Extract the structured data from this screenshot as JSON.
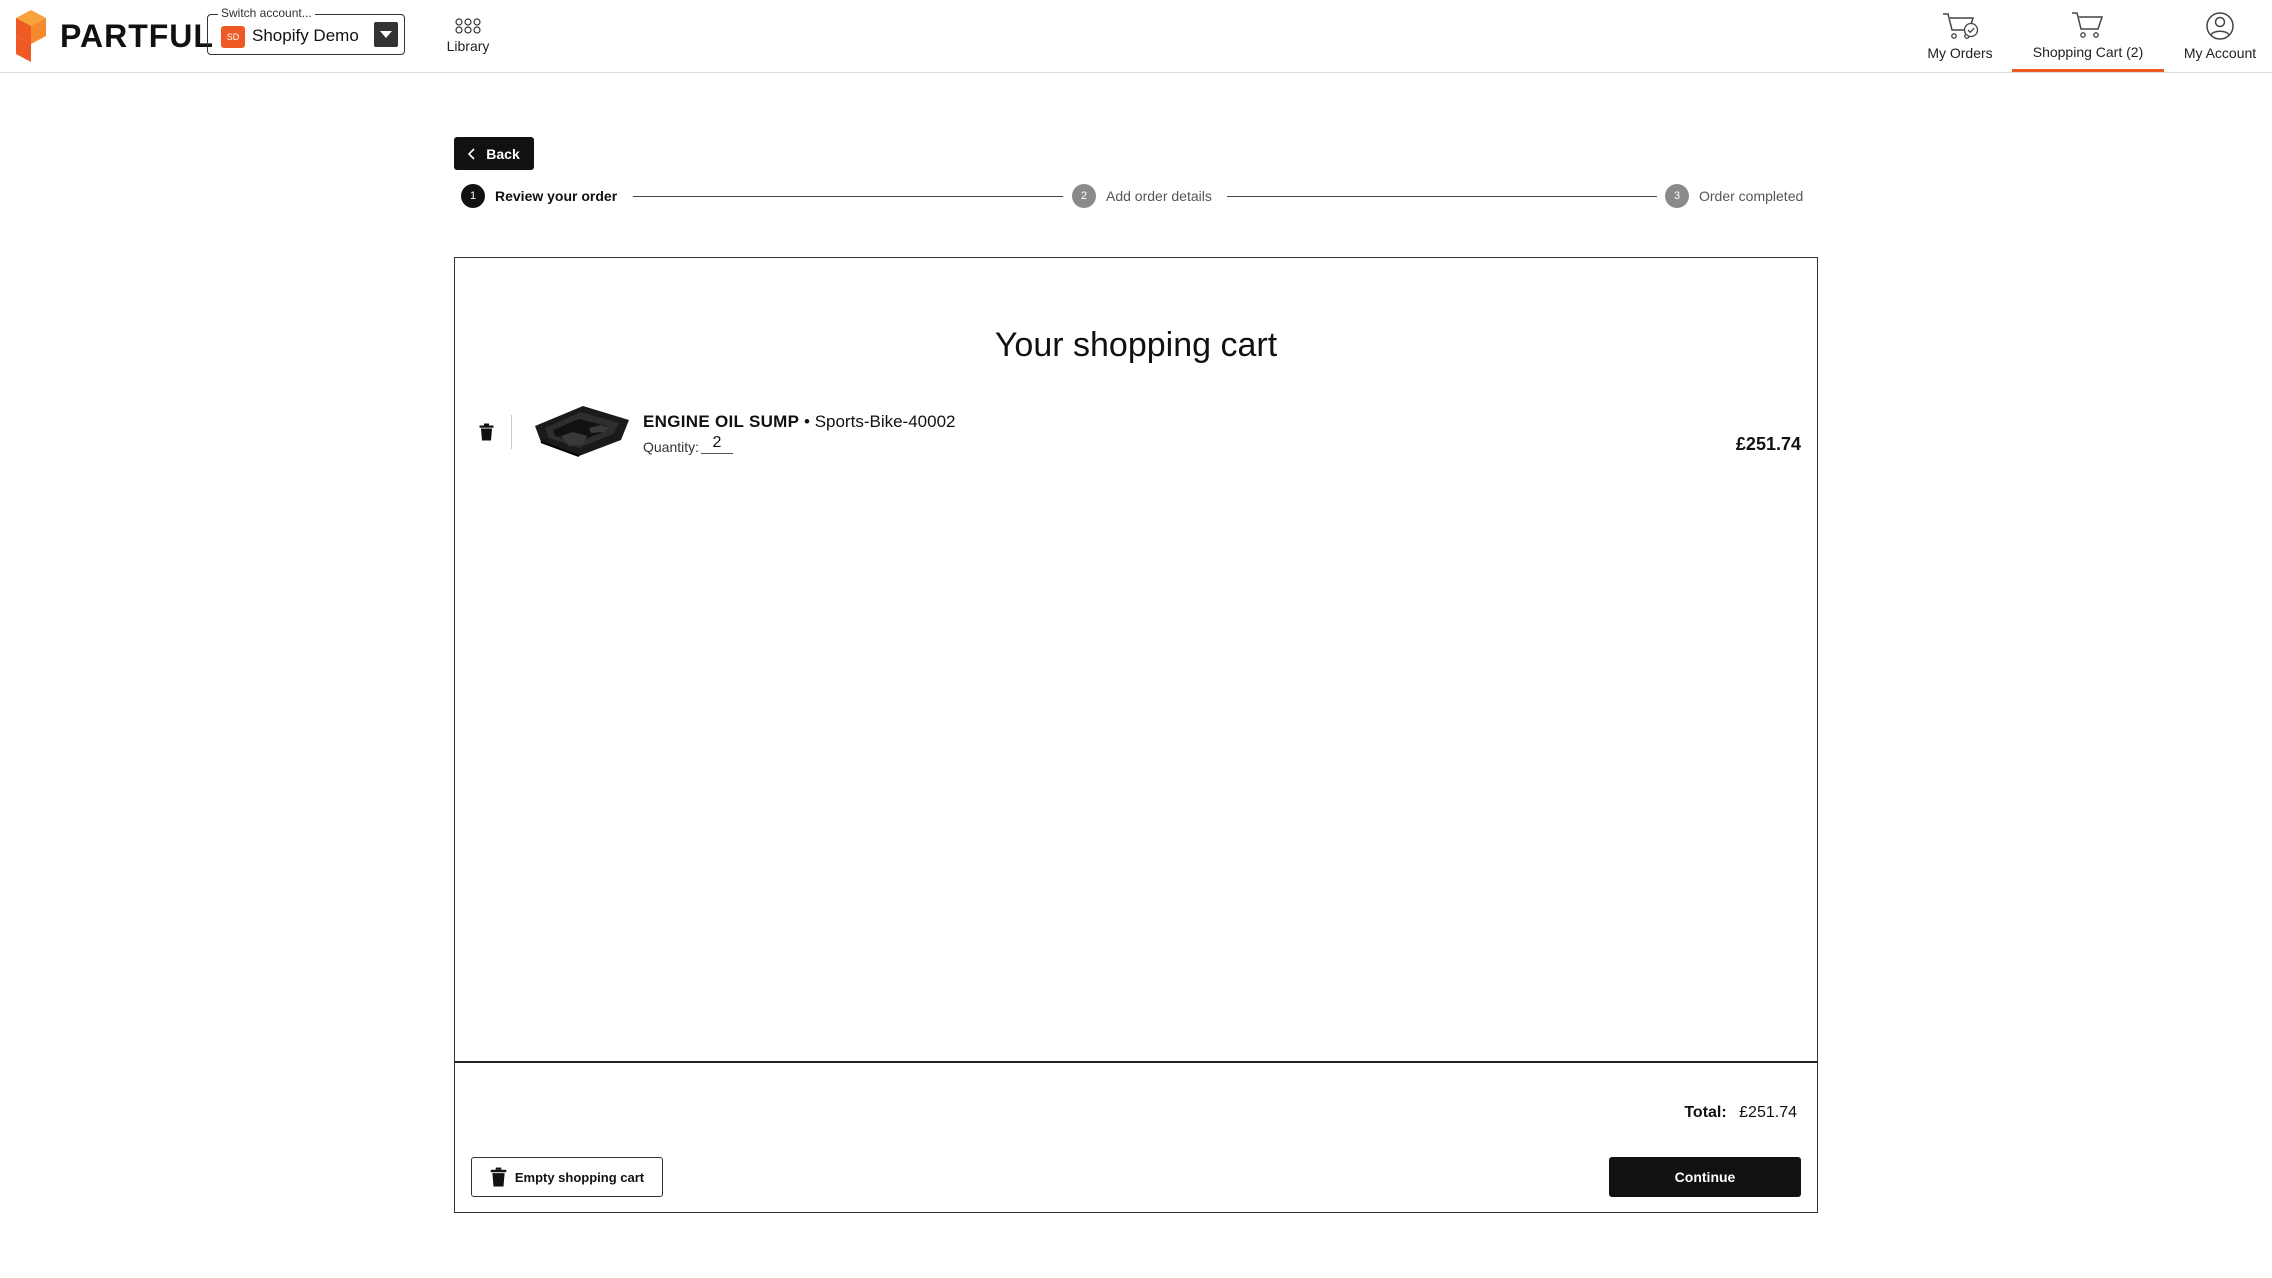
{
  "app": {
    "logo_text": "PARTFUL",
    "brand_color": "#ef5a24"
  },
  "account_switcher": {
    "legend": "Switch account...",
    "badge": "SD",
    "name": "Shopify Demo"
  },
  "nav": {
    "library": "Library",
    "my_orders": "My Orders",
    "shopping_cart": "Shopping Cart (2)",
    "my_account": "My Account"
  },
  "back_label": "Back",
  "steps": [
    {
      "num": "1",
      "label": "Review your order",
      "active": true
    },
    {
      "num": "2",
      "label": "Add order details",
      "active": false
    },
    {
      "num": "3",
      "label": "Order completed",
      "active": false
    }
  ],
  "cart": {
    "title": "Your shopping cart",
    "items": [
      {
        "name": "ENGINE OIL SUMP",
        "separator": "•",
        "variant": "Sports-Bike-40002",
        "quantity_label": "Quantity:",
        "quantity": "2",
        "price": "£251.74"
      }
    ],
    "total_label": "Total:",
    "total_value": "£251.74",
    "empty_label": "Empty shopping cart",
    "continue_label": "Continue"
  }
}
